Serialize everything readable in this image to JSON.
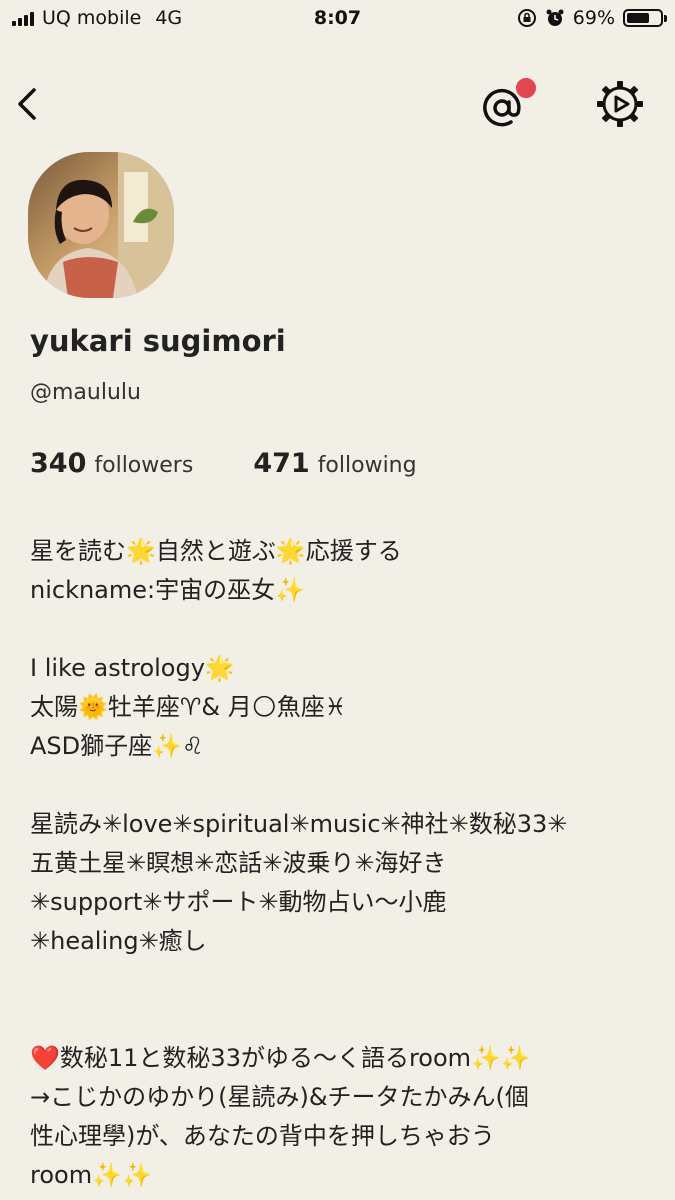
{
  "status_bar": {
    "carrier": "UQ mobile",
    "network": "4G",
    "time": "8:07",
    "battery": "69%",
    "battery_level": 0.69
  },
  "nav": {
    "back_icon": "chevron-left-icon",
    "mention_icon": "at-sign-icon",
    "settings_icon": "gear-icon",
    "notification_color": "#e2474f"
  },
  "profile": {
    "name": "yukari sugimori",
    "handle": "@maululu",
    "followers_count": "340",
    "followers_label": "followers",
    "following_count": "471",
    "following_label": "following"
  },
  "bio": {
    "lines": [
      "星を読む🌟自然と遊ぶ🌟応援する",
      "nickname:宇宙の巫女✨",
      "",
      "I like astrology🌟",
      "太陽🌞牡羊座♈& 月🌕魚座♓",
      "ASD獅子座✨♌",
      "",
      "星読み✳love✳spiritual✳music✳神社✳数秘33✳",
      "五黄土星✳瞑想✳恋話✳波乗り✳海好き",
      "✳support✳サポート✳動物占い〜小鹿",
      "✳healing✳癒し",
      "",
      "",
      "❤️数秘11と数秘33がゆる〜く語るroom✨✨",
      "→こじかのゆかり(星読み)&チータたかみん(個",
      "性心理學)が、あなたの背中を押しちゃおう",
      "room✨✨"
    ]
  }
}
